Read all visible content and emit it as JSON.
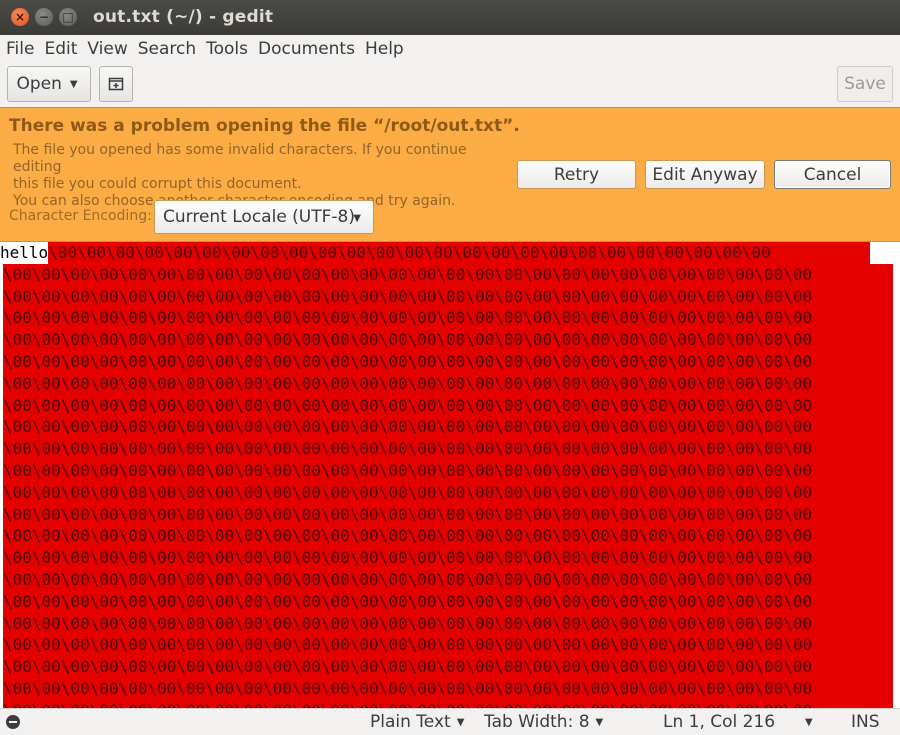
{
  "window": {
    "title": "out.txt (~/) - gedit",
    "close_glyph": "×",
    "minimize_glyph": "−",
    "maximize_glyph": "□"
  },
  "menubar": {
    "items": [
      "File",
      "Edit",
      "View",
      "Search",
      "Tools",
      "Documents",
      "Help"
    ]
  },
  "toolbar": {
    "open_label": "Open",
    "new_tab_icon": "new-document-icon",
    "save_label": "Save"
  },
  "infobar": {
    "title": "There was a problem opening the file “/root/out.txt”.",
    "message_lines": [
      "The file you opened has some invalid characters. If you continue editing",
      "this file you could corrupt this document.",
      "You can also choose another character encoding and try again."
    ],
    "retry_label": "Retry",
    "edit_anyway_label": "Edit Anyway",
    "cancel_label": "Cancel",
    "encoding_label": "Character Encoding:",
    "encoding_value": "Current Locale (UTF-8)",
    "background_color": "#fbac45"
  },
  "editor": {
    "first_line_text": "hello",
    "invalid_token": "\\00",
    "invalid_bg_color": "#e50000",
    "visible_invalid_lines": 21
  },
  "statusbar": {
    "language": "Plain Text",
    "tab_width": "Tab Width: 8",
    "position": "Ln 1, Col 216",
    "mode": "INS"
  }
}
